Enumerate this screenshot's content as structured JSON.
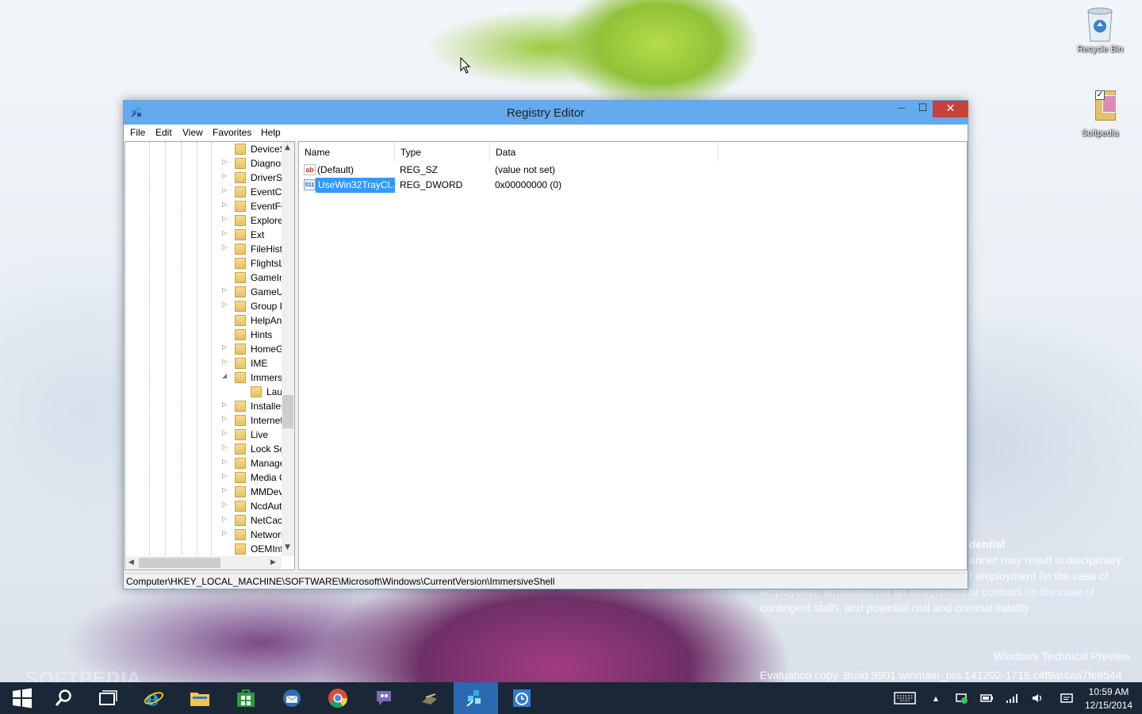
{
  "desktop": {
    "icons": [
      {
        "label": "Recycle Bin",
        "icon": "recycle-bin-icon"
      },
      {
        "label": "Softpedia",
        "icon": "shortcut-image-icon"
      }
    ],
    "watermark": {
      "lines": [
        "dential",
        "anner may result in disciplinary",
        "f employment (in the case of",
        "employees), termination of an assignment or contract (in the case of",
        "contingent staff), and potential civil and criminal liability."
      ],
      "product": "Windows Technical Preview",
      "build": "Evaluation copy. Build 9901.winmain_prs.141202-1718.c4f9af4aa7fe8544"
    },
    "logo_text": "SOFTPEDIA"
  },
  "window": {
    "title": "Registry Editor",
    "accent": "#64aaee",
    "close_color": "#c7413a",
    "buttons": {
      "minimize": "—",
      "maximize": "☐",
      "close": "✕"
    },
    "menu": [
      "File",
      "Edit",
      "View",
      "Favorites",
      "Help"
    ],
    "tree": [
      {
        "label": "DeviceSetup",
        "expander": ""
      },
      {
        "label": "Diagnostics",
        "expander": "▷"
      },
      {
        "label": "DriverSearching",
        "expander": "▷"
      },
      {
        "label": "EventCollector",
        "expander": "▷"
      },
      {
        "label": "EventForwarding",
        "expander": "▷"
      },
      {
        "label": "Explorer",
        "expander": "▷"
      },
      {
        "label": "Ext",
        "expander": "▷"
      },
      {
        "label": "FileHistory",
        "expander": "▷"
      },
      {
        "label": "FlightsLog",
        "expander": ""
      },
      {
        "label": "GameInstaller",
        "expander": ""
      },
      {
        "label": "GameUX",
        "expander": "▷"
      },
      {
        "label": "Group Policy",
        "expander": "▷"
      },
      {
        "label": "HelpAndSupport",
        "expander": ""
      },
      {
        "label": "Hints",
        "expander": ""
      },
      {
        "label": "HomeGroup",
        "expander": "▷"
      },
      {
        "label": "IME",
        "expander": "▷"
      },
      {
        "label": "ImmersiveShell",
        "expander": "◢"
      },
      {
        "label": "Launcher",
        "expander": "",
        "child": true
      },
      {
        "label": "Installer",
        "expander": "▷"
      },
      {
        "label": "Internet Settings",
        "expander": "▷"
      },
      {
        "label": "Live",
        "expander": "▷"
      },
      {
        "label": "Lock Screen",
        "expander": "▷"
      },
      {
        "label": "Management",
        "expander": "▷"
      },
      {
        "label": "Media Center",
        "expander": "▷"
      },
      {
        "label": "MMDevices",
        "expander": "▷"
      },
      {
        "label": "NcdAutoSetup",
        "expander": "▷"
      },
      {
        "label": "NetCache",
        "expander": "▷"
      },
      {
        "label": "Network",
        "expander": "▷"
      },
      {
        "label": "OEMInformation",
        "expander": ""
      }
    ],
    "columns": [
      "Name",
      "Type",
      "Data"
    ],
    "values": [
      {
        "name": "(Default)",
        "type": "REG_SZ",
        "data": "(value not set)",
        "icon": "string-value-icon",
        "selected": false
      },
      {
        "name": "UseWin32TrayCl...",
        "type": "REG_DWORD",
        "data": "0x00000000 (0)",
        "icon": "binary-value-icon",
        "selected": true
      }
    ],
    "status_path": "Computer\\HKEY_LOCAL_MACHINE\\SOFTWARE\\Microsoft\\Windows\\CurrentVersion\\ImmersiveShell"
  },
  "taskbar": {
    "apps": [
      "start-button",
      "search-button",
      "task-view-button",
      "internet-explorer",
      "file-explorer",
      "store",
      "thunderbird",
      "chrome",
      "pidgin",
      "terminal",
      "registry-editor",
      "alarms"
    ],
    "active_app": "registry-editor",
    "clock": {
      "time": "10:59 AM",
      "date": "12/15/2014"
    }
  }
}
